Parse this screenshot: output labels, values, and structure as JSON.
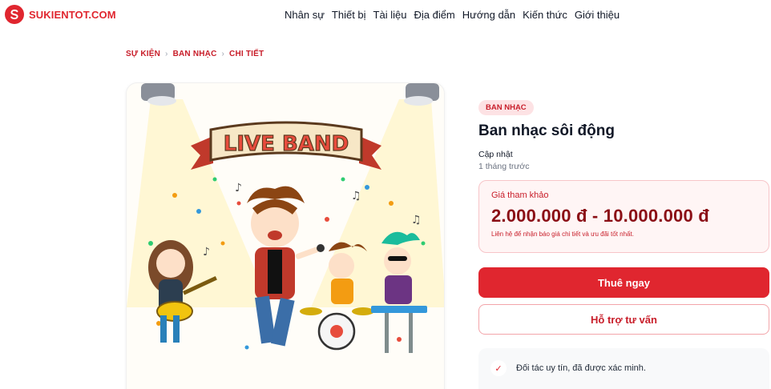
{
  "brand": {
    "name": "SUKIENTOT.COM",
    "accent": "#e0262f"
  },
  "nav": {
    "items": [
      "Nhân sự",
      "Thiết bị",
      "Tài liệu",
      "Địa điểm",
      "Hướng dẫn",
      "Kiến thức",
      "Giới thiệu"
    ]
  },
  "breadcrumb": {
    "items": [
      "SỰ KIỆN",
      "BAN NHẠC",
      "CHI TIẾT"
    ],
    "separator": "›"
  },
  "image": {
    "banner_text": "LIVE BAND"
  },
  "product": {
    "badge": "BAN NHẠC",
    "title": "Ban nhạc sôi động",
    "updated_label": "Cập nhật",
    "updated_value": "1 tháng trước"
  },
  "price": {
    "label": "Giá tham khảo",
    "value": "2.000.000 đ - 10.000.000 đ",
    "note": "Liên hệ để nhận báo giá chi tiết và ưu đãi tốt nhất."
  },
  "actions": {
    "primary": "Thuê ngay",
    "secondary": "Hỗ trợ tư vấn"
  },
  "features": {
    "items": [
      "Đối tác uy tín, đã được xác minh."
    ],
    "check_glyph": "✓"
  }
}
